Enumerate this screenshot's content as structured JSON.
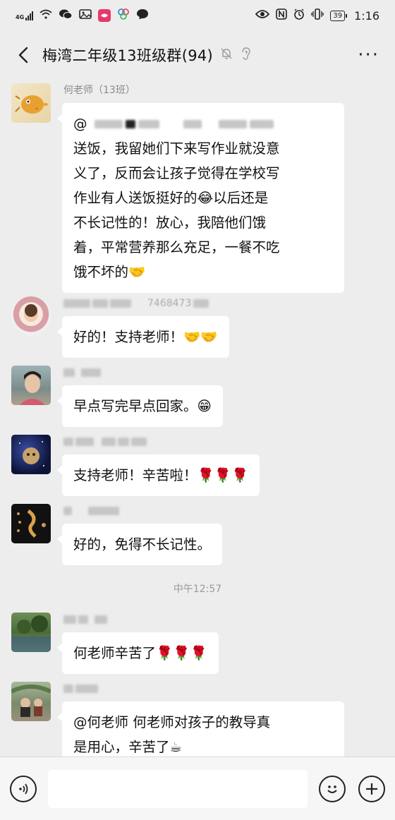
{
  "status_bar": {
    "network": "4G",
    "battery": "39",
    "time": "1:16"
  },
  "header": {
    "title": "梅湾二年级13班级群(94)",
    "more": "···",
    "back_icon": "back-chevron-icon",
    "mute_icon": "bell-off-icon",
    "ear_icon": "ear-icon"
  },
  "messages": [
    {
      "sender": "何老师（13班）",
      "lines": [
        "@",
        "送饭，我留她们下来写作业就没意",
        "义了，反而会让孩子觉得在学校写",
        "作业有人送饭挺好的😂以后还是",
        "不长记性的！放心，我陪他们饿",
        "着，平常营养那么充足，一餐不吃",
        "饿不坏的🤝"
      ]
    },
    {
      "sender_partial": "7468473",
      "text": "好的！支持老师！🤝🤝"
    },
    {
      "text": "早点写完早点回家。😁"
    },
    {
      "text": "支持老师！辛苦啦！🌹🌹🌹"
    },
    {
      "text": "好的，免得不长记性。"
    },
    {
      "text": "何老师辛苦了🌹🌹🌹"
    },
    {
      "text": "@何老师  何老师对孩子的教导真",
      "text2": "是用心，辛苦了☕"
    }
  ],
  "timestamp": "中午12:57",
  "input": {
    "voice_icon": "voice-icon",
    "emoji_icon": "emoji-icon",
    "plus_icon": "plus-icon"
  }
}
